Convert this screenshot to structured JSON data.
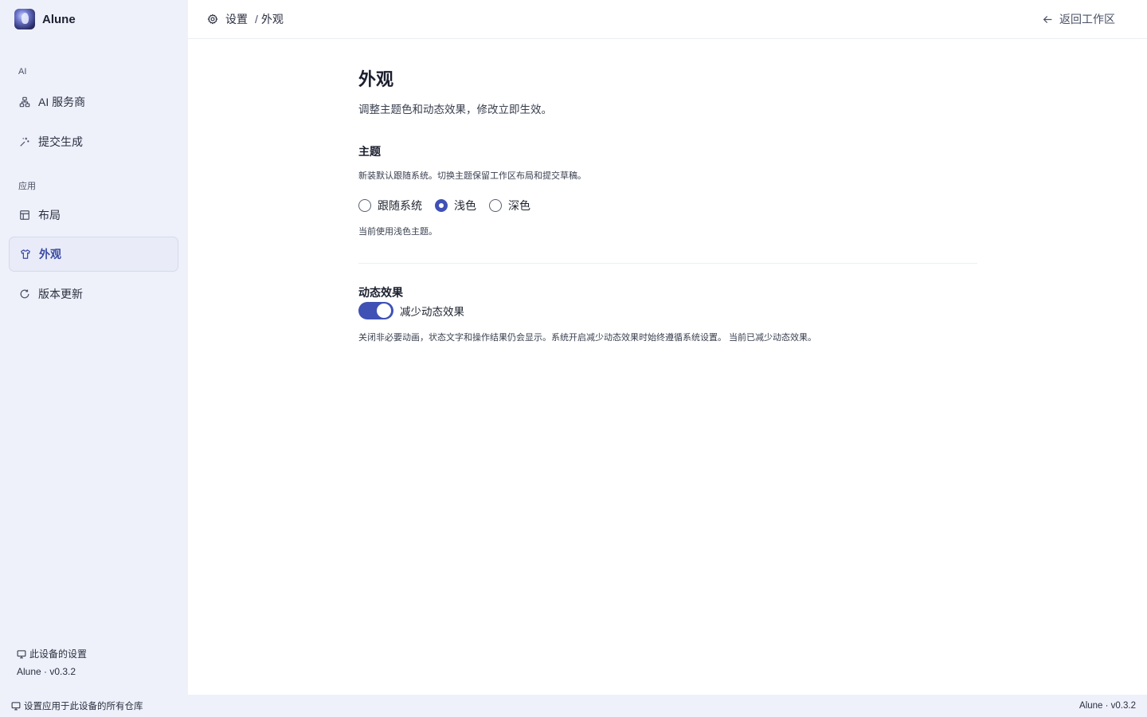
{
  "app": {
    "name": "Alune"
  },
  "sidebar": {
    "sections": [
      {
        "label": "AI"
      },
      {
        "label": "应用"
      }
    ],
    "items": [
      {
        "label": "AI 服务商",
        "icon": "network-icon"
      },
      {
        "label": "提交生成",
        "icon": "sparkles-icon"
      },
      {
        "label": "布局",
        "icon": "layout-icon"
      },
      {
        "label": "外观",
        "icon": "shirt-icon",
        "active": true
      },
      {
        "label": "版本更新",
        "icon": "refresh-icon"
      }
    ],
    "footer": {
      "device_label": "此设备的设置",
      "version": "Alune · v0.3.2"
    }
  },
  "header": {
    "breadcrumb_root": "设置",
    "breadcrumb_sep": "/",
    "breadcrumb_current": "外观",
    "back_label": "返回工作区"
  },
  "page": {
    "title": "外观",
    "subtitle": "调整主题色和动态效果，修改立即生效。",
    "theme": {
      "title": "主题",
      "description": "新装默认跟随系统。切换主题保留工作区布局和提交草稿。",
      "options": [
        "跟随系统",
        "浅色",
        "深色"
      ],
      "selected": "浅色",
      "status": "当前使用浅色主题。"
    },
    "motion": {
      "title": "动态效果",
      "toggle_label": "减少动态效果",
      "toggle_on": true,
      "description": "关闭非必要动画，状态文字和操作结果仍会显示。系统开启减少动态效果时始终遵循系统设置。 当前已减少动态效果。"
    }
  },
  "statusbar": {
    "left": "设置应用于此设备的所有仓库",
    "right": "Alune · v0.3.2"
  },
  "colors": {
    "accent": "#3f51b5",
    "sidebar_bg": "#eef1fa"
  }
}
